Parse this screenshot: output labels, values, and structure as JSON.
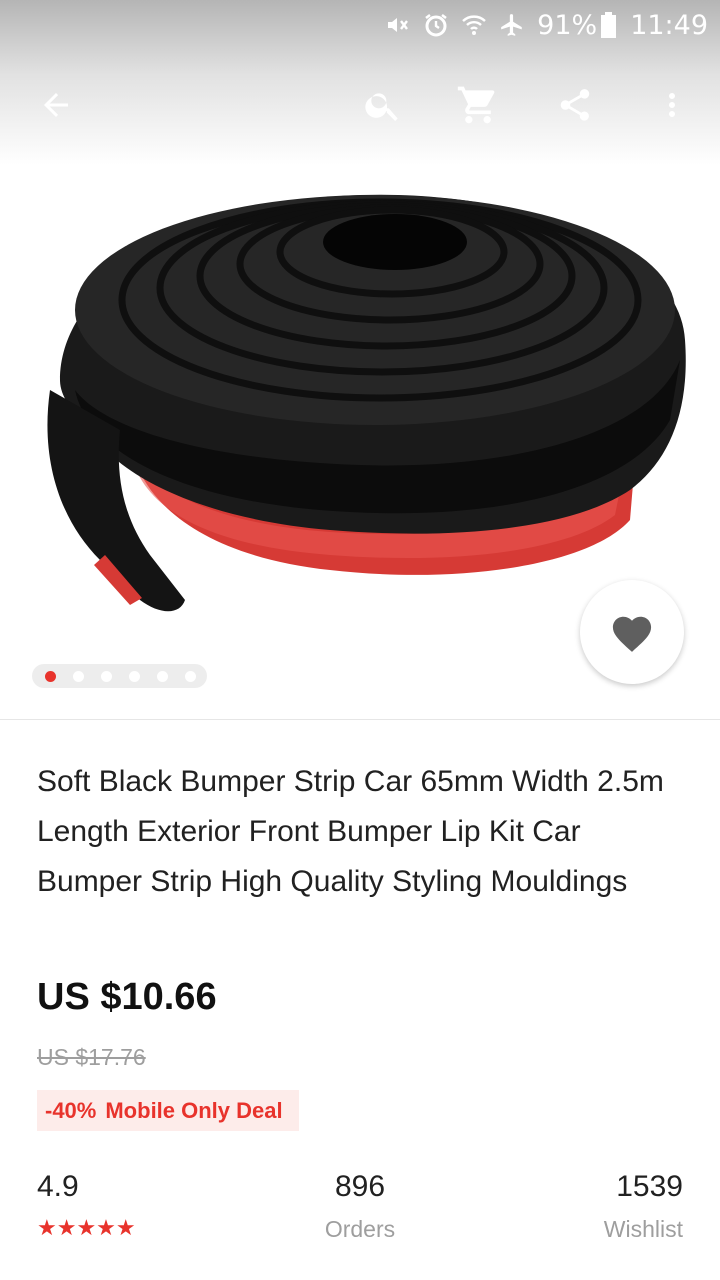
{
  "status_bar": {
    "battery": "91%",
    "time": "11:49",
    "icons": [
      "mute-icon",
      "alarm-icon",
      "wifi-icon",
      "airplane-icon",
      "battery-icon"
    ]
  },
  "toolbar": {
    "icons": [
      "back-arrow-icon",
      "search-icon",
      "cart-icon",
      "share-icon",
      "more-vert-icon"
    ]
  },
  "gallery": {
    "image_count": 6,
    "active_index": 0
  },
  "product": {
    "title": "Soft Black Bumper Strip Car 65mm Width 2.5m Length Exterior Front Bumper Lip Kit Car Bumper Strip High Quality Styling Mouldings",
    "price": "US $10.66",
    "original_price": "US $17.76",
    "discount": "-40%",
    "deal_label": "Mobile Only Deal"
  },
  "stats": {
    "rating": "4.9",
    "stars": "★★★★★",
    "orders": "896",
    "orders_label": "Orders",
    "wishlist": "1539",
    "wishlist_label": "Wishlist"
  },
  "colors": {
    "accent": "#e8332c",
    "deal_background": "#fdecea",
    "muted_text": "#9e9e9e"
  }
}
